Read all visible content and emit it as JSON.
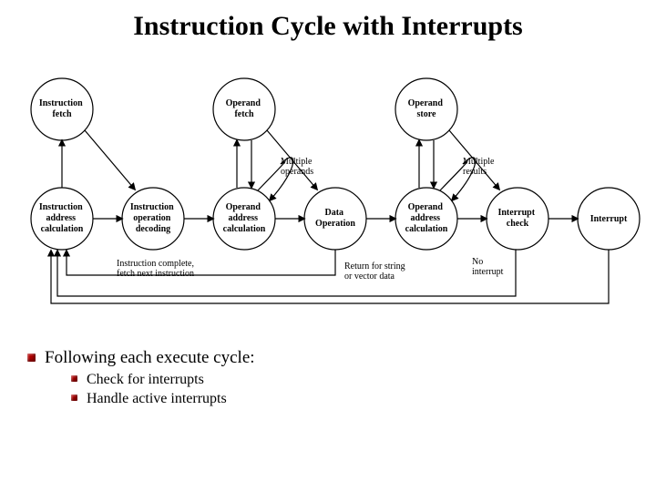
{
  "title": "Instruction Cycle with Interrupts",
  "bullet_main": "Following each execute cycle:",
  "bullet_sub1": "Check for interrupts",
  "bullet_sub2": "Handle active interrupts",
  "diagram": {
    "top_nodes": {
      "ifetch": "Instruction\nfetch",
      "ofetch": "Operand\nfetch",
      "ostore": "Operand\nstore"
    },
    "bottom_nodes": {
      "iac": "Instruction\naddress\ncalculation",
      "iod": "Instruction\noperation\ndecoding",
      "oac": "Operand\naddress\ncalculation",
      "dop": "Data\nOperation",
      "oac2": "Operand\naddress\ncalculation",
      "icheck": "Interrupt\ncheck",
      "intr": "Interrupt"
    },
    "annotations": {
      "mult_op": "Multiple\noperands",
      "mult_res": "Multiple\nresults",
      "complete": "Instruction complete,\nfetch next instruction",
      "return": "Return for string\nor vector data",
      "noint": "No\ninterrupt"
    }
  }
}
